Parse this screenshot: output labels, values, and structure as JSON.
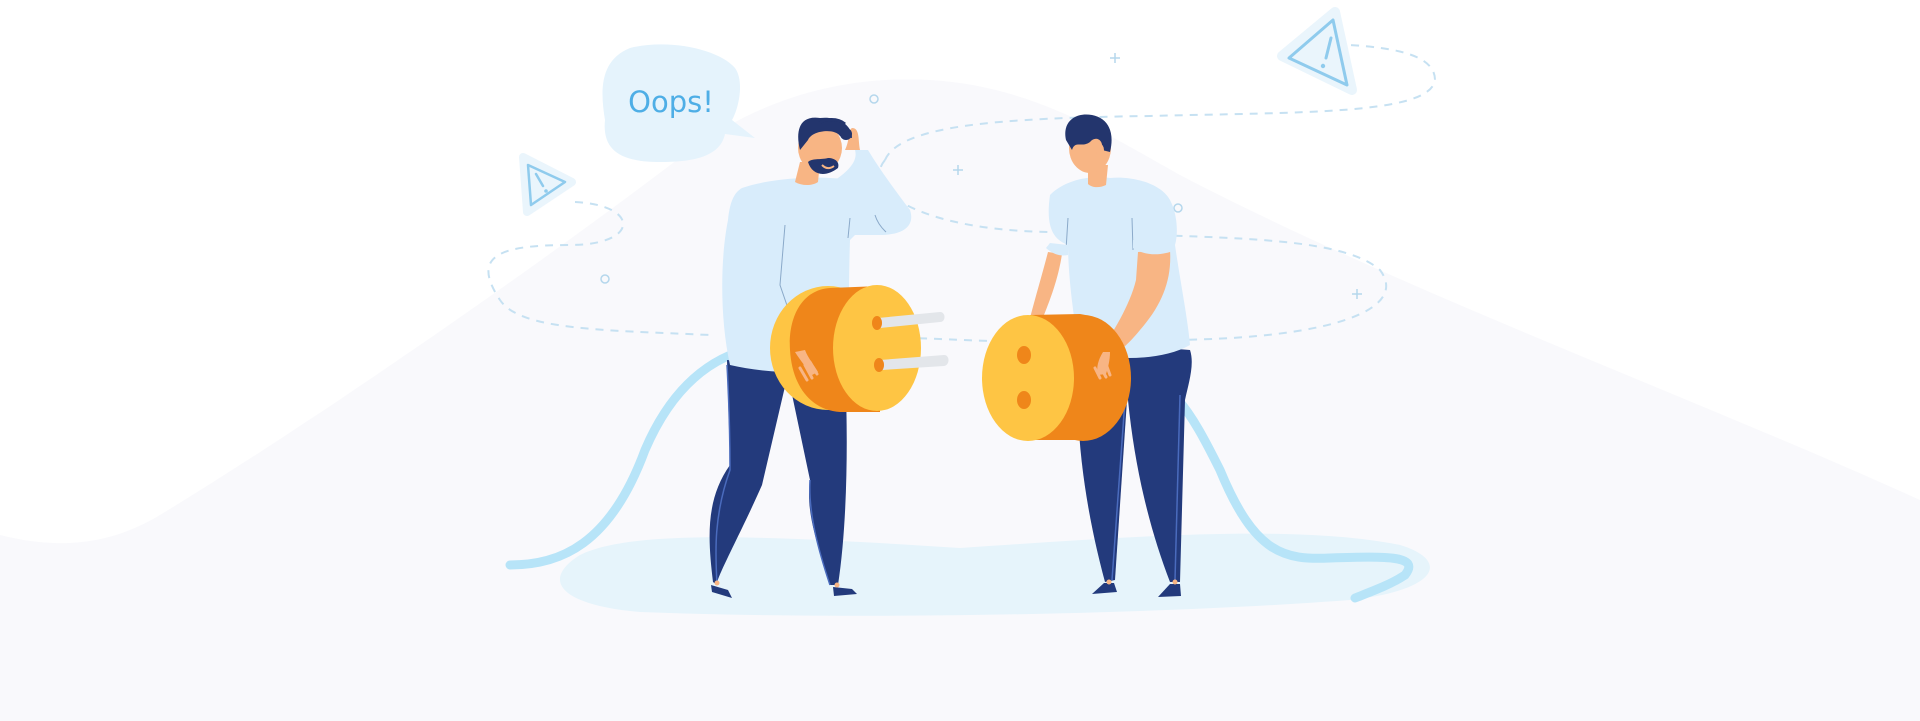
{
  "illustration": {
    "speech_bubble_text": "Oops!"
  },
  "colors": {
    "background": "#ffffff",
    "hill": "#f9f9fc",
    "floor_shadow": "#e6f4fb",
    "accent_blue": "#4eaee6",
    "bubble_fill": "#e5f3fc",
    "shirt": "#d8ecfb",
    "pants": "#233a7c",
    "hair": "#23356d",
    "skin": "#f8b584",
    "plug_yellow": "#fec544",
    "plug_orange": "#ef861a",
    "prong": "#e3e6ea",
    "cable": "#b7e4f8",
    "dashed_line": "#c6e1f2",
    "warning_icon": "#8fcbed"
  },
  "icons": [
    "warning-triangle-icon",
    "speech-bubble-icon",
    "electrical-plug-icon",
    "electrical-socket-icon",
    "sparkle-plus-icon",
    "small-circle-icon"
  ]
}
